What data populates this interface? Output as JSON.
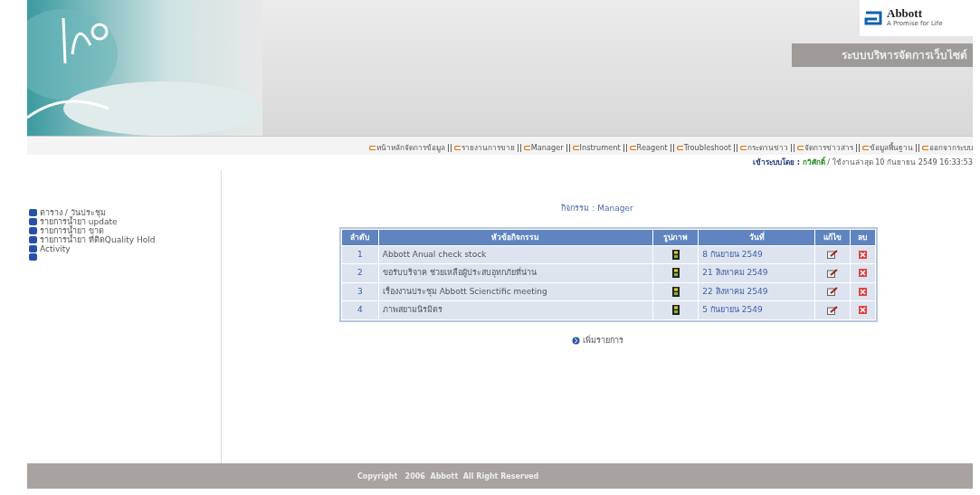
{
  "header": {
    "logo": "Abbott",
    "tagline": "A Promise for Life",
    "banner": "ระบบบริหารจัดการเว็บไซต์"
  },
  "menu": [
    "หน้าหลักจัดการข้อมูล",
    "รายงานการขาย",
    "Manager",
    "Instrument",
    "Reagent",
    "Troubleshoot",
    "กระดานข่าว",
    "จัดการข่าวสาร",
    "ข้อมูลพื้นฐาน",
    "ออกจากระบบ"
  ],
  "login": {
    "label": "เข้าระบบโดย :",
    "user": "กวิศักดิ์",
    "last_used": "/ ใช้งานล่าสุด 10 กันยายน 2549 16:33:53"
  },
  "sidebar": {
    "items": [
      {
        "kind": "link",
        "label": "ตาราง / วันประชุม"
      },
      {
        "kind": "link",
        "label": "รายการน้ำยา update"
      },
      {
        "kind": "link",
        "label": "รายการน้ำยา ขาด"
      },
      {
        "kind": "link",
        "label": "รายการน้ำยา ที่ติดQuality Hold"
      },
      {
        "kind": "link",
        "label": "Activity"
      },
      {
        "kind": "icon_only"
      }
    ]
  },
  "page_title": "กิจกรรม : Manager",
  "table": {
    "columns": [
      "ลำดับ",
      "หัวข้อกิจกรรม",
      "รูปภาพ",
      "วันที่",
      "แก้ไข",
      "ลบ"
    ],
    "rows": [
      {
        "no": "1",
        "title": "Abbott Anual check stock",
        "date": "8 กันยายน 2549"
      },
      {
        "no": "2",
        "title": "ขอรับบริจาค ช่วยเหลือผู้ประสบอุทกภัยที่น่าน",
        "date": "21 สิงหาคม 2549"
      },
      {
        "no": "3",
        "title": "เรื่องงานประชุม Abbott Scienctific meeting",
        "date": "22 สิงหาคม 2549"
      },
      {
        "no": "4",
        "title": "ภาพสยามนิรมิตร",
        "date": "5 กันยายน 2549"
      }
    ]
  },
  "add_link": "เพิ่มรายการ",
  "footer": "Copyright   2006  Abbott  All Right Reserved"
}
